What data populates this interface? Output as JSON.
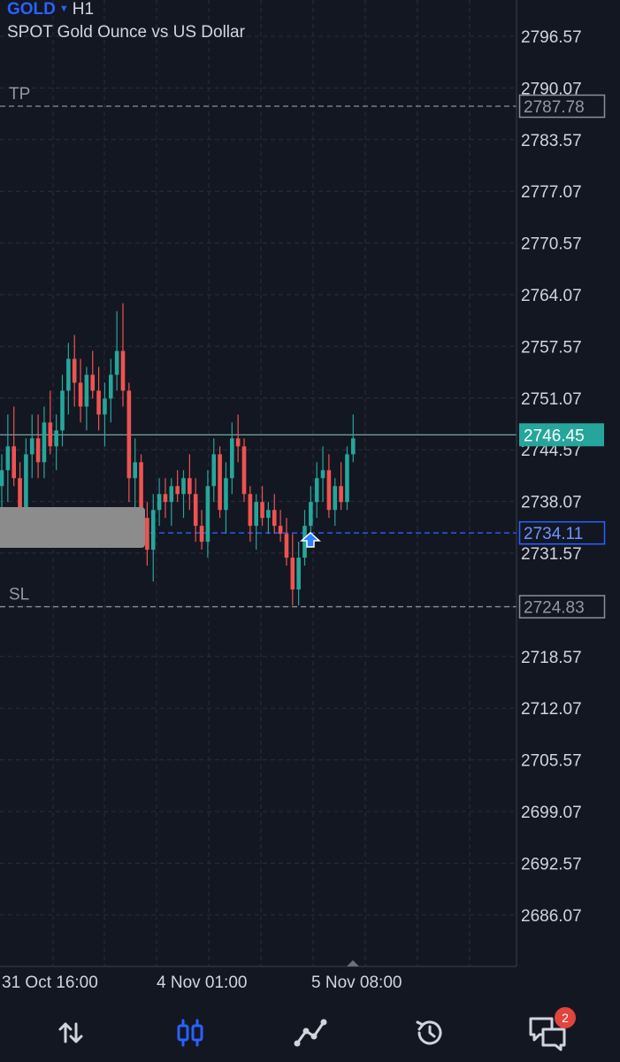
{
  "header": {
    "symbol": "GOLD",
    "timeframe": "H1",
    "description": "SPOT Gold Ounce vs US Dollar"
  },
  "chart_data": {
    "type": "candlestick",
    "price_axis_ticks": [
      2796.57,
      2790.07,
      2783.57,
      2777.07,
      2770.57,
      2764.07,
      2757.57,
      2751.07,
      2744.57,
      2738.07,
      2731.57,
      2724.83,
      2718.57,
      2712.07,
      2705.57,
      2699.07,
      2692.57,
      2686.07
    ],
    "price_axis_labels": [
      "2796.57",
      "2790.07",
      "2783.57",
      "2777.07",
      "2770.57",
      "2764.07",
      "2757.57",
      "2751.07",
      "2744.57",
      "2738.07",
      "2731.57",
      "",
      "2718.57",
      "2712.07",
      "2705.57",
      "2699.07",
      "2692.57",
      "2686.07"
    ],
    "time_labels": [
      "31 Oct 16:00",
      "4 Nov 01:00",
      "5 Nov 08:00"
    ],
    "y_range": [
      2679.8,
      2800.0
    ],
    "grid": true,
    "levels": [
      {
        "name": "TP",
        "label": "TP",
        "price": 2787.78,
        "price_label": "2787.78",
        "color": "#8a8f9c"
      },
      {
        "name": "SL",
        "label": "SL",
        "price": 2724.83,
        "price_label": "2724.83",
        "color": "#8a8f9c"
      },
      {
        "name": "entry",
        "label": "",
        "price": 2734.11,
        "price_label": "2734.11",
        "color": "#2962ff"
      },
      {
        "name": "current",
        "label": "",
        "price": 2746.45,
        "price_label": "2746.45",
        "color": "#26a69a"
      }
    ],
    "candles": [
      [
        2740,
        2744,
        2734,
        2742
      ],
      [
        2742,
        2749,
        2738,
        2745
      ],
      [
        2745,
        2750,
        2740,
        2741
      ],
      [
        2741,
        2743,
        2735,
        2737
      ],
      [
        2737,
        2746,
        2735,
        2744
      ],
      [
        2744,
        2749,
        2741,
        2746
      ],
      [
        2746,
        2749,
        2741,
        2743
      ],
      [
        2743,
        2750,
        2741,
        2748
      ],
      [
        2748,
        2752,
        2744,
        2745
      ],
      [
        2745,
        2749,
        2742,
        2747
      ],
      [
        2747,
        2754,
        2745,
        2752
      ],
      [
        2752,
        2758,
        2749,
        2756
      ],
      [
        2756,
        2759,
        2750,
        2753
      ],
      [
        2753,
        2756,
        2748,
        2750
      ],
      [
        2750,
        2755,
        2747,
        2754
      ],
      [
        2754,
        2757,
        2751,
        2752
      ],
      [
        2752,
        2755,
        2747,
        2749
      ],
      [
        2749,
        2753,
        2745,
        2751
      ],
      [
        2751,
        2756,
        2748,
        2754
      ],
      [
        2754,
        2762,
        2752,
        2757
      ],
      [
        2757,
        2763,
        2750,
        2752
      ],
      [
        2752,
        2753,
        2738,
        2741
      ],
      [
        2741,
        2746,
        2737,
        2743
      ],
      [
        2743,
        2744,
        2734,
        2736
      ],
      [
        2736,
        2738,
        2730,
        2732
      ],
      [
        2732,
        2739,
        2728,
        2737
      ],
      [
        2737,
        2741,
        2735,
        2739
      ],
      [
        2739,
        2741,
        2736,
        2738
      ],
      [
        2738,
        2741,
        2735,
        2740
      ],
      [
        2740,
        2742,
        2738,
        2739
      ],
      [
        2739,
        2742,
        2736,
        2741
      ],
      [
        2741,
        2744,
        2737,
        2739
      ],
      [
        2739,
        2741,
        2733,
        2735
      ],
      [
        2735,
        2737,
        2732,
        2733
      ],
      [
        2733,
        2742,
        2731,
        2740
      ],
      [
        2740,
        2746,
        2738,
        2744
      ],
      [
        2744,
        2745,
        2736,
        2737
      ],
      [
        2737,
        2743,
        2734,
        2741
      ],
      [
        2741,
        2748,
        2739,
        2746
      ],
      [
        2746,
        2749,
        2743,
        2745
      ],
      [
        2745,
        2746,
        2738,
        2739
      ],
      [
        2739,
        2740,
        2733,
        2735
      ],
      [
        2735,
        2739,
        2732,
        2738
      ],
      [
        2738,
        2740,
        2735,
        2736
      ],
      [
        2736,
        2738,
        2734,
        2737
      ],
      [
        2737,
        2739,
        2734,
        2735
      ],
      [
        2735,
        2737,
        2733,
        2734
      ],
      [
        2734,
        2736,
        2730,
        2731
      ],
      [
        2731,
        2734,
        2725,
        2727
      ],
      [
        2727,
        2733,
        2725,
        2731
      ],
      [
        2731,
        2737,
        2730,
        2735
      ],
      [
        2735,
        2740,
        2733,
        2738
      ],
      [
        2738,
        2743,
        2736,
        2741
      ],
      [
        2741,
        2745,
        2738,
        2742
      ],
      [
        2742,
        2744,
        2736,
        2737
      ],
      [
        2737,
        2741,
        2735,
        2740
      ],
      [
        2740,
        2743,
        2737,
        2738
      ],
      [
        2738,
        2745,
        2737,
        2744
      ],
      [
        2744,
        2749,
        2743,
        2746
      ]
    ]
  },
  "bottom_nav": {
    "items": [
      {
        "name": "quotes",
        "icon": "arrows-up-down-icon",
        "active": false
      },
      {
        "name": "chart",
        "icon": "candlestick-icon",
        "active": true
      },
      {
        "name": "trade",
        "icon": "trade-line-icon",
        "active": false
      },
      {
        "name": "history",
        "icon": "history-icon",
        "active": false
      },
      {
        "name": "messages",
        "icon": "chat-icon",
        "active": false
      }
    ],
    "messages_badge": "2"
  },
  "colors": {
    "background": "#131722",
    "grid": "#2a2e39",
    "text": "#d1d4dc",
    "up": "#26a69a",
    "down": "#ef5350",
    "accent": "#2962ff",
    "badge": "#e0453e"
  }
}
